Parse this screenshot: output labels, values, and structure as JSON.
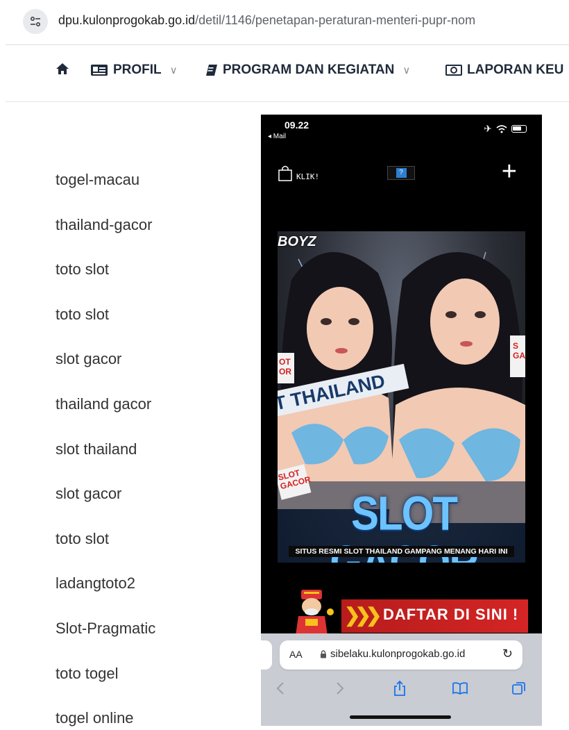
{
  "browser": {
    "url_host": "dpu.kulonprogokab.go.id",
    "url_path": "/detil/1146/penetapan-peraturan-menteri-pupr-nom"
  },
  "nav": {
    "items": [
      {
        "label": "PROFIL",
        "icon": "id-card-icon"
      },
      {
        "label": "PROGRAM DAN KEGIATAN",
        "icon": "book-icon"
      },
      {
        "label": "LAPORAN KEU",
        "icon": "money-icon"
      }
    ]
  },
  "sidebar": {
    "links": [
      "togel-macau",
      "thailand-gacor",
      "toto slot",
      "toto slot",
      "slot gacor",
      "thailand gacor",
      "slot thailand",
      "slot gacor",
      "toto slot",
      "ladangtoto2",
      "Slot-Pragmatic",
      "toto togel",
      "togel online"
    ]
  },
  "phone": {
    "time": "09.22",
    "back_label": "◂ Mail",
    "toolbar": {
      "bag_label": "KLIK!",
      "question_label": "?"
    },
    "poster": {
      "brand": "BOYZ",
      "ribbon": "T THAILAND",
      "badge_left": "SLOT GACOR",
      "badge_right": "S GA",
      "badge_top_left": "OT OR",
      "headline": "SLOT GACOR",
      "subtitle": "SITUS RESMI SLOT THAILAND GAMPANG MENANG HARI INI",
      "skin_color": "#f2c9b3",
      "bikini_color": "#6fb6e0",
      "hair_color": "#14131a"
    },
    "banner": {
      "label": "DAFTAR DI SINI !"
    },
    "safari": {
      "aa_label": "AA",
      "domain": "sibelaku.kulonprogokab.go.id",
      "reload_icon": "reload-icon"
    }
  }
}
